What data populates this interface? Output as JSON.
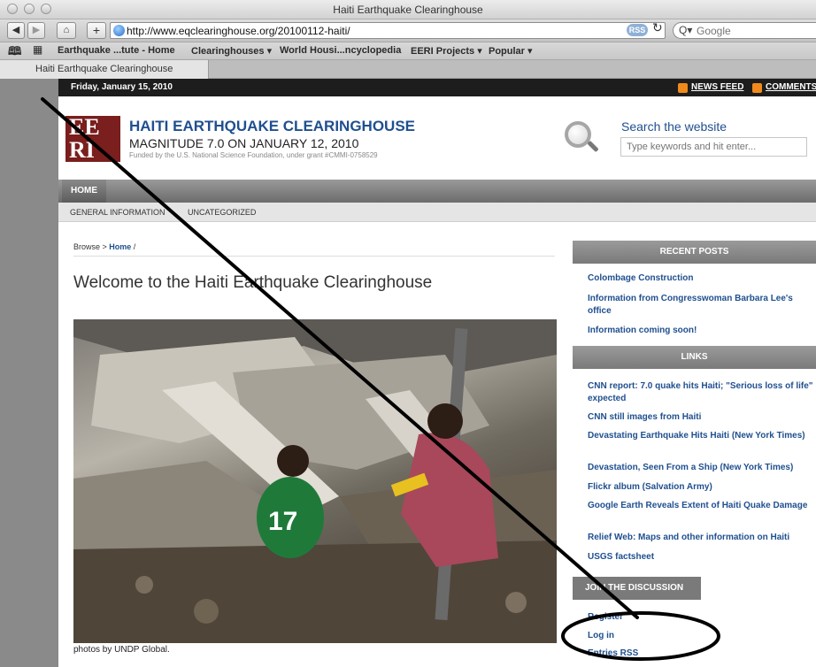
{
  "browser": {
    "window_title": "Haiti Earthquake Clearinghouse",
    "url": "http://www.eqclearinghouse.org/20100112-haiti/",
    "rss_label": "RSS",
    "search_placeholder": "Google",
    "bookmarks": [
      "Earthquake ...tute - Home",
      "Clearinghouses ▾",
      "World Housi...ncyclopedia",
      "EERI Projects ▾",
      "Popular ▾"
    ],
    "tab_title": "Haiti Earthquake Clearinghouse"
  },
  "page": {
    "date": "Friday, January 15, 2010",
    "news_feed": "NEWS FEED",
    "comments": "COMMENTS",
    "logo_letters": "EERI",
    "site_title": "HAITI EARTHQUAKE CLEARINGHOUSE",
    "site_subtitle": "MAGNITUDE 7.0 ON JANUARY 12, 2010",
    "site_funding": "Funded by the U.S. National Science Foundation, under grant #CMMI-0758529",
    "search_label": "Search the website",
    "search_placeholder": "Type keywords and hit enter...",
    "nav_home": "HOME",
    "subnav": [
      "GENERAL INFORMATION",
      "UNCATEGORIZED"
    ],
    "breadcrumb_prefix": "Browse > ",
    "breadcrumb_home": "Home",
    "breadcrumb_suffix": " /",
    "welcome": "Welcome to the Haiti Earthquake Clearinghouse",
    "photo_caption": "photos by UNDP Global.",
    "jersey_number": "17",
    "recent_posts_heading": "RECENT POSTS",
    "recent_posts": [
      "Colombage Construction",
      "Information from Congresswoman Barbara Lee's office",
      "Information coming soon!"
    ],
    "links_heading": "LINKS",
    "links": [
      "CNN report: 7.0 quake hits Haiti; \"Serious loss of life\" expected",
      "CNN still images from Haiti",
      "Devastating Earthquake Hits Haiti (New York Times)",
      "Devastation, Seen From a Ship (New York Times)",
      "Flickr album (Salvation Army)",
      "Google Earth Reveals Extent of Haiti Quake Damage",
      "Relief Web: Maps and other information on Haiti",
      "USGS factsheet"
    ],
    "join_heading": "JOIN THE DISCUSSION",
    "join_links": [
      "Register",
      "Log in",
      "Entries RSS"
    ]
  }
}
